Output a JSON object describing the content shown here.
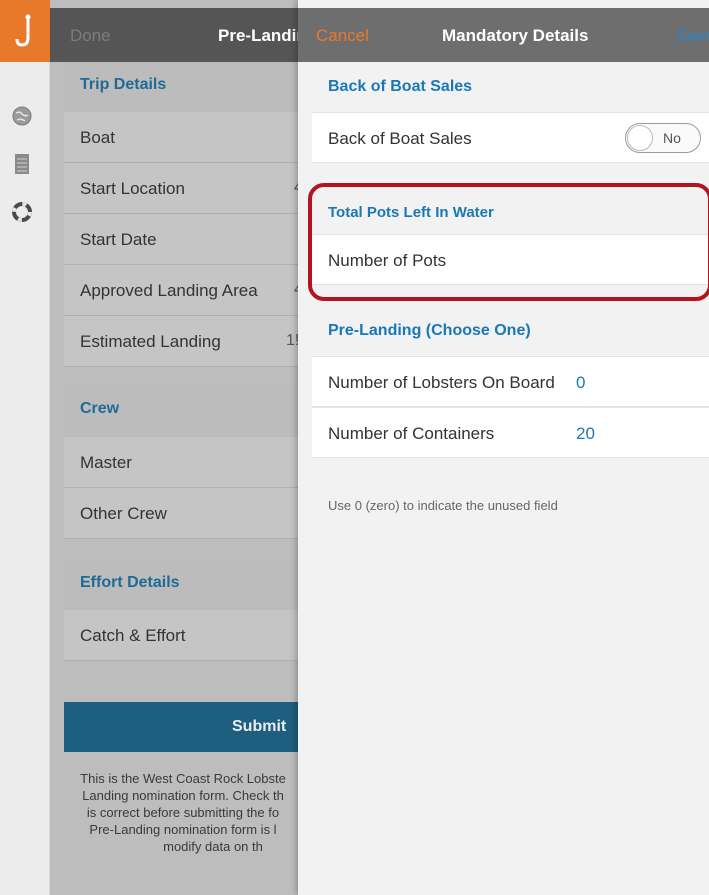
{
  "rail": {
    "logo_icon": "hook-icon",
    "icons": [
      "globe-icon",
      "document-list-icon",
      "lifebuoy-icon"
    ]
  },
  "background_form": {
    "nav": {
      "done_label": "Done",
      "title": "Pre-Landir"
    },
    "sections": {
      "trip_details": "Trip Details",
      "crew": "Crew",
      "effort_details": "Effort Details"
    },
    "rows": {
      "boat": {
        "label": "Boat"
      },
      "start_location": {
        "label": "Start Location",
        "value": "4"
      },
      "start_date": {
        "label": "Start Date"
      },
      "approved_landing_area": {
        "label": "Approved Landing Area",
        "value": "4"
      },
      "estimated_landing": {
        "label": "Estimated Landing",
        "value": "1!"
      },
      "master": {
        "label": "Master"
      },
      "other_crew": {
        "label": "Other Crew"
      },
      "catch_effort": {
        "label": "Catch & Effort"
      }
    },
    "submit_label": "Submit",
    "footer_lines": [
      "This is the West Coast Rock Lobste",
      "Landing nomination form. Check th",
      "is correct before submitting the fo",
      "Pre-Landing nomination form is l",
      "modify data on th"
    ]
  },
  "modal": {
    "nav": {
      "cancel_label": "Cancel",
      "title": "Mandatory Details",
      "save_label": "Save"
    },
    "back_of_boat_section": "Back of Boat Sales",
    "back_of_boat_row": {
      "label": "Back of Boat Sales",
      "toggle_value": "No"
    },
    "total_pots_section": "Total Pots Left In Water",
    "number_of_pots_row": {
      "label": "Number of Pots",
      "value": ""
    },
    "pre_landing_section": "Pre-Landing (Choose One)",
    "lobsters_row": {
      "label": "Number of Lobsters On Board",
      "value": "0"
    },
    "containers_row": {
      "label": "Number of Containers",
      "value": "20"
    },
    "hint": "Use 0 (zero) to indicate the unused field"
  },
  "colors": {
    "accent_orange": "#e8792b",
    "link_blue": "#1a78b8",
    "submit_blue": "#1e5e7e",
    "highlight_red": "#b3151f"
  }
}
